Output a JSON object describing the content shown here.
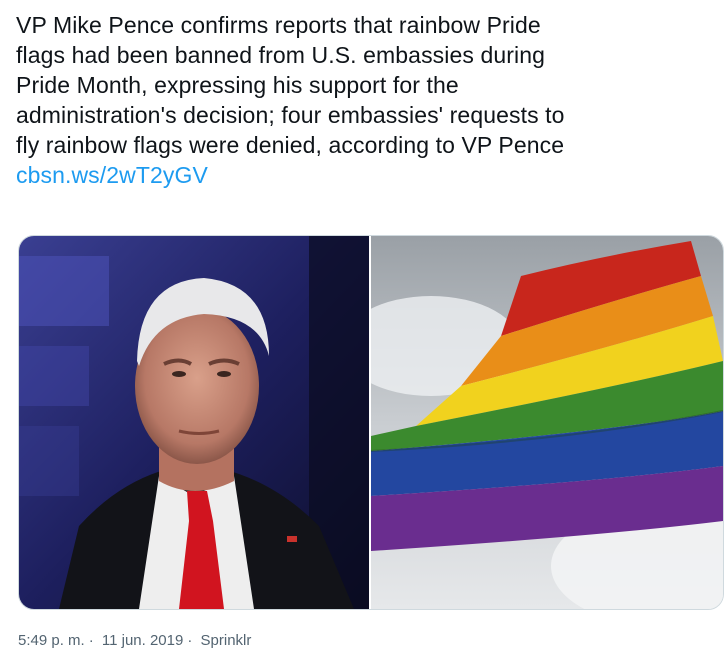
{
  "tweet": {
    "text_lines": [
      "VP Mike Pence confirms reports that rainbow Pride",
      "flags had been banned from U.S. embassies during",
      "Pride Month, expressing his support for the",
      "administration's decision; four embassies' requests to",
      "fly rainbow flags were denied, according to VP Pence"
    ],
    "link": "cbsn.ws/2wT2yGV"
  },
  "media": {
    "left_photo": "portrait-photo",
    "right_photo": "rainbow-flag-photo"
  },
  "meta": {
    "time": "5:49 p. m.",
    "separator": "·",
    "date": "11 jun. 2019",
    "source": "Sprinklr"
  },
  "colors": {
    "link": "#1d9bf0",
    "meta": "#536471",
    "border": "#cfd9de"
  }
}
